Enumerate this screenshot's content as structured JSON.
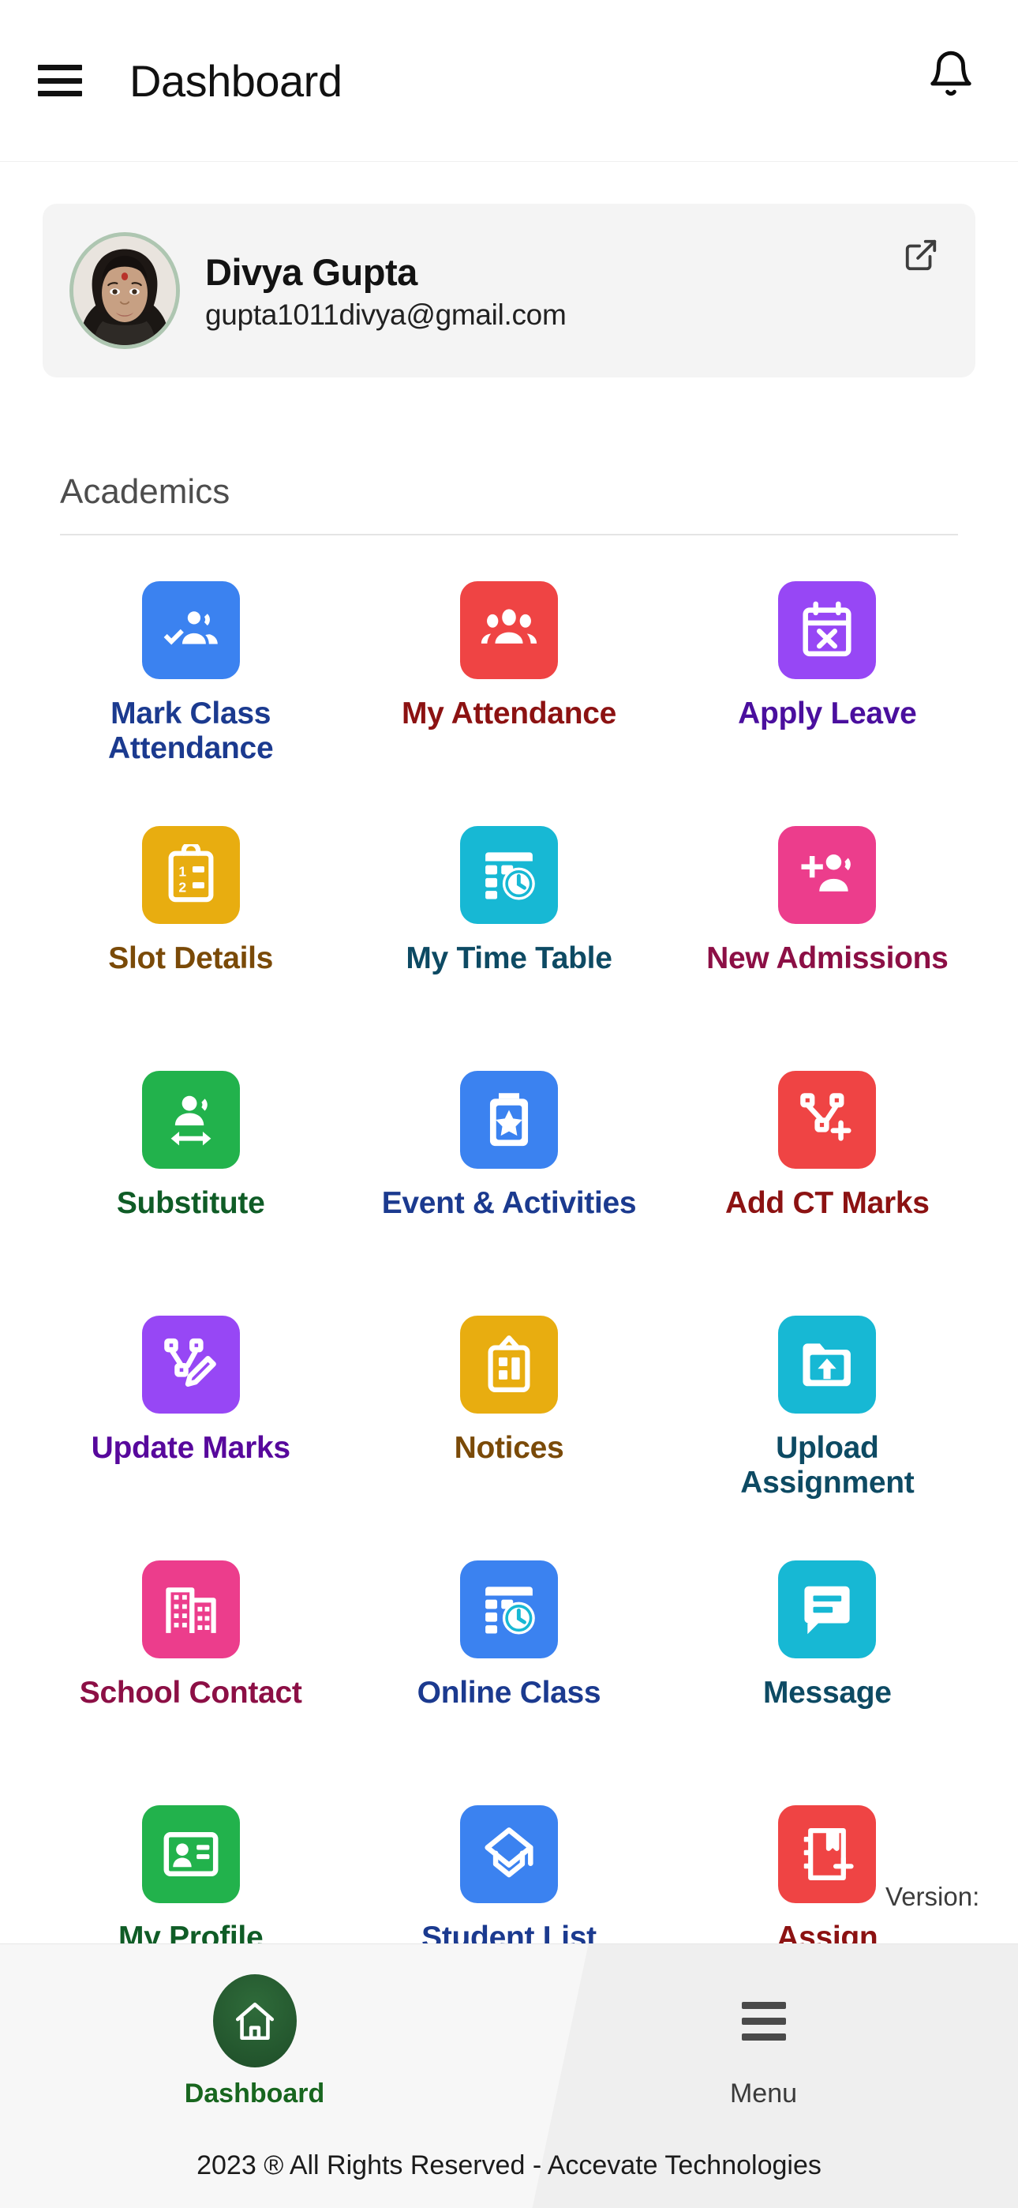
{
  "header": {
    "title": "Dashboard",
    "menu_icon": "hamburger-menu-icon",
    "notification_icon": "bell-icon"
  },
  "profile": {
    "name": "Divya Gupta",
    "email": "gupta1011divya@gmail.com",
    "avatar_icon": "user-avatar-photo",
    "open_icon": "open-in-new-icon"
  },
  "section": {
    "title": "Academics"
  },
  "tiles": [
    {
      "label": "Mark Class Attendance",
      "icon": "attendance-check-icon",
      "bg": "#3b82f0",
      "text": "#1b3a8f"
    },
    {
      "label": "My Attendance",
      "icon": "people-group-icon",
      "bg": "#ef4444",
      "text": "#8c1212"
    },
    {
      "label": "Apply Leave",
      "icon": "calendar-cross-icon",
      "bg": "#9747f5",
      "text": "#4a0f9e"
    },
    {
      "label": "Slot Details",
      "icon": "clipboard-list-icon",
      "bg": "#e8ad10",
      "text": "#7a4a08"
    },
    {
      "label": "My Time Table",
      "icon": "timetable-clock-icon",
      "bg": "#17b8d4",
      "text": "#0d4a63"
    },
    {
      "label": "New Admissions",
      "icon": "person-add-icon",
      "bg": "#ec3d8c",
      "text": "#8c0f45"
    },
    {
      "label": "Substitute",
      "icon": "person-swap-icon",
      "bg": "#22b24c",
      "text": "#0f5c26"
    },
    {
      "label": "Event & Activities",
      "icon": "event-star-icon",
      "bg": "#3b82f0",
      "text": "#1b3a8f"
    },
    {
      "label": "Add CT Marks",
      "icon": "graph-add-icon",
      "bg": "#ef4444",
      "text": "#8c1212"
    },
    {
      "label": "Update Marks",
      "icon": "graph-edit-icon",
      "bg": "#9747f5",
      "text": "#57089c"
    },
    {
      "label": "Notices",
      "icon": "notice-board-icon",
      "bg": "#e8ad10",
      "text": "#7a4a08"
    },
    {
      "label": "Upload Assignment",
      "icon": "folder-upload-icon",
      "bg": "#17b8d4",
      "text": "#0d4a63"
    },
    {
      "label": "School Contact",
      "icon": "building-icon",
      "bg": "#ec3d8c",
      "text": "#8c0f45"
    },
    {
      "label": "Online Class",
      "icon": "timetable-clock-icon",
      "bg": "#3b82f0",
      "text": "#1b3a8f"
    },
    {
      "label": "Message",
      "icon": "chat-message-icon",
      "bg": "#17b8d4",
      "text": "#0d4a63"
    },
    {
      "label": "My Profile",
      "icon": "id-card-icon",
      "bg": "#22b24c",
      "text": "#0f5c26"
    },
    {
      "label": "Student List",
      "icon": "graduation-cap-icon",
      "bg": "#3b82f0",
      "text": "#1b3a8f"
    },
    {
      "label": "Assign Homework",
      "icon": "book-add-icon",
      "bg": "#ef4444",
      "text": "#8c1212"
    }
  ],
  "version": {
    "label": "Version:"
  },
  "bottom_nav": {
    "items": [
      {
        "label": "Dashboard",
        "icon": "home-icon",
        "active": true
      },
      {
        "label": "Menu",
        "icon": "hamburger-menu-icon",
        "active": false
      }
    ]
  },
  "footer": {
    "text": "2023 ® All Rights Reserved - Accevate Technologies"
  },
  "colors": {
    "accent_green": "#18661f",
    "card_bg": "#f4f4f4",
    "bottom_bg": "#f7f7f7"
  }
}
